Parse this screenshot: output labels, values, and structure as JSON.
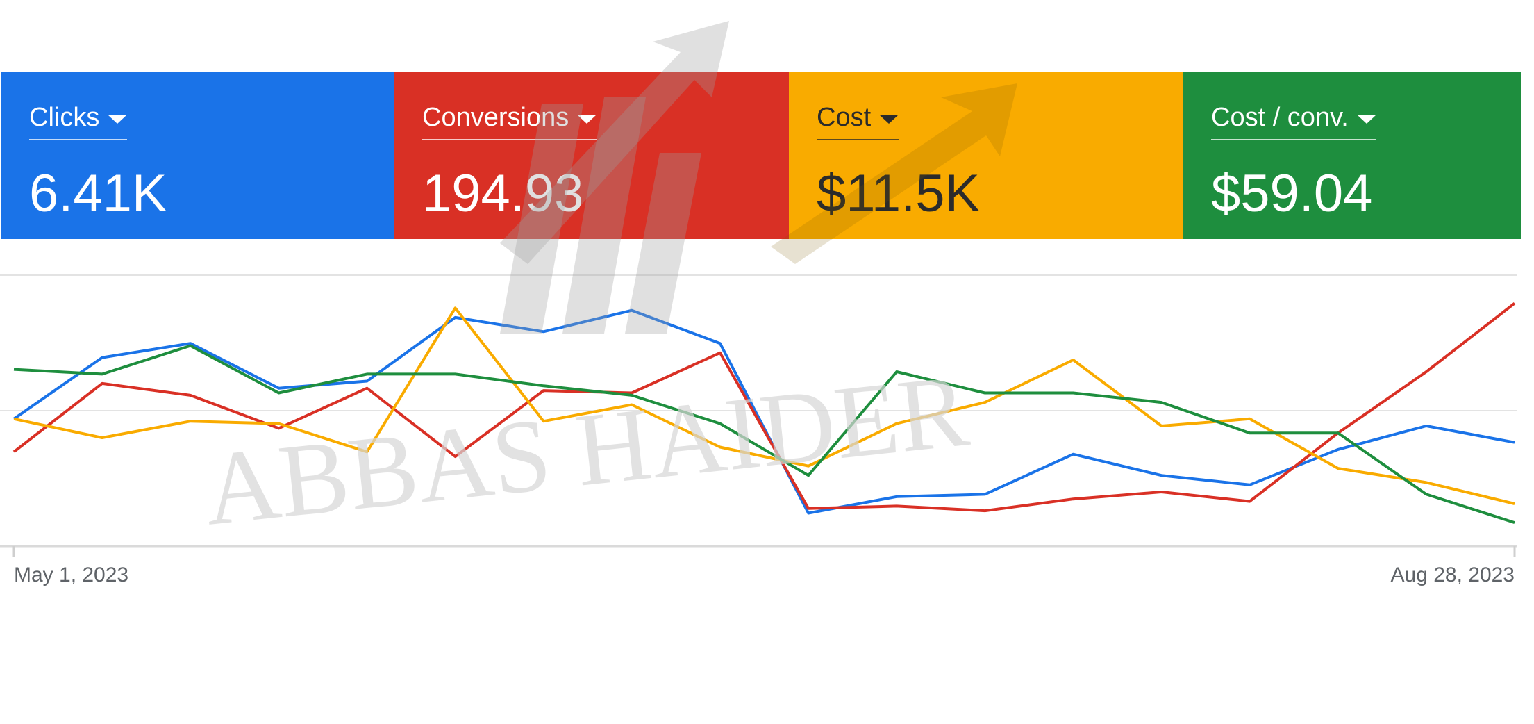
{
  "metric_cards": [
    {
      "label": "Clicks",
      "value": "6.41K",
      "color": "#1a73e8",
      "text": "light"
    },
    {
      "label": "Conversions",
      "value": "194.93",
      "color": "#d93025",
      "text": "light"
    },
    {
      "label": "Cost",
      "value": "$11.5K",
      "color": "#f9ab00",
      "text": "dark"
    },
    {
      "label": "Cost / conv.",
      "value": "$59.04",
      "color": "#1e8e3e",
      "text": "light"
    }
  ],
  "watermark": {
    "text": "ABBAS HAIDER"
  },
  "chart_data": {
    "type": "line",
    "x_start_label": "May 1, 2023",
    "x_end_label": "Aug 28, 2023",
    "x_count": 18,
    "normalized": true,
    "grid": true,
    "series": [
      {
        "name": "Clicks",
        "color": "#1a73e8",
        "values": [
          0.51,
          0.77,
          0.83,
          0.64,
          0.67,
          0.94,
          0.88,
          0.97,
          0.83,
          0.11,
          0.18,
          0.19,
          0.36,
          0.27,
          0.23,
          0.38,
          0.48,
          0.41
        ]
      },
      {
        "name": "Conversions",
        "color": "#d93025",
        "values": [
          0.37,
          0.66,
          0.61,
          0.47,
          0.64,
          0.35,
          0.63,
          0.62,
          0.79,
          0.13,
          0.14,
          0.12,
          0.17,
          0.2,
          0.16,
          0.45,
          0.71,
          1.0
        ]
      },
      {
        "name": "Cost",
        "color": "#f9ab00",
        "values": [
          0.51,
          0.43,
          0.5,
          0.49,
          0.37,
          0.98,
          0.5,
          0.57,
          0.39,
          0.31,
          0.49,
          0.58,
          0.76,
          0.48,
          0.51,
          0.3,
          0.24,
          0.15
        ]
      },
      {
        "name": "Cost / conv.",
        "color": "#1e8e3e",
        "values": [
          0.72,
          0.7,
          0.82,
          0.62,
          0.7,
          0.7,
          0.65,
          0.61,
          0.49,
          0.27,
          0.71,
          0.62,
          0.62,
          0.58,
          0.45,
          0.45,
          0.19,
          0.07
        ]
      }
    ]
  }
}
